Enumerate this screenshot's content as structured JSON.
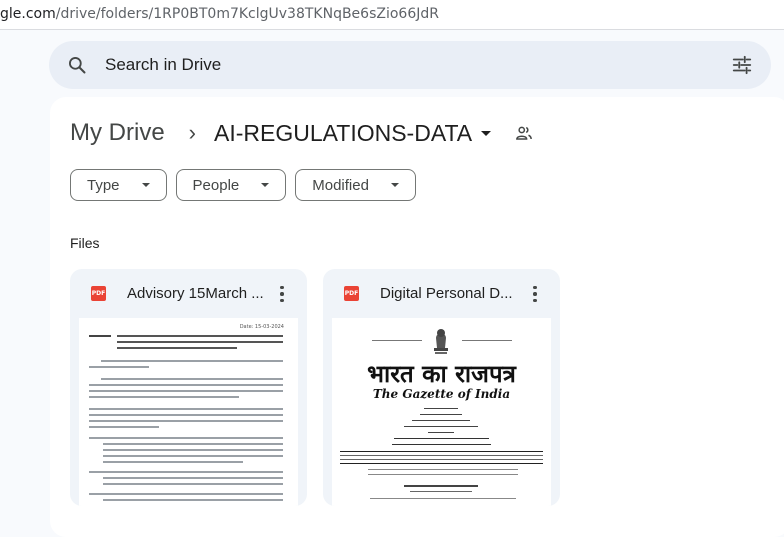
{
  "browser": {
    "url_host": "gle.com",
    "url_path": "/drive/folders/1RP0BT0m7KclgUv38TKNqBe6sZio66JdR"
  },
  "search": {
    "placeholder": "Search in Drive",
    "search_icon": "search-icon",
    "filter_icon": "tune-icon"
  },
  "breadcrumb": {
    "root": "My Drive",
    "separator": "›",
    "current": "AI-REGULATIONS-DATA",
    "shared_icon": "shared-people-icon"
  },
  "filters": [
    {
      "label": "Type"
    },
    {
      "label": "People"
    },
    {
      "label": "Modified"
    }
  ],
  "section": {
    "files_label": "Files"
  },
  "files": [
    {
      "name": "Advisory 15March ...",
      "type_badge": "PDF",
      "type_icon": "pdf-icon"
    },
    {
      "name": "Digital Personal D...",
      "type_badge": "PDF",
      "type_icon": "pdf-icon"
    }
  ],
  "thumbnails": {
    "advisory_date": "Date: 15-03-2024",
    "gazette_hindi": "भारत का राजपत्र",
    "gazette_english": "The Gazette of India"
  },
  "colors": {
    "page_bg": "#f8fafd",
    "search_bg": "#e9eef6",
    "card_bg": "#f0f4f9",
    "pdf_red": "#ea4335"
  }
}
